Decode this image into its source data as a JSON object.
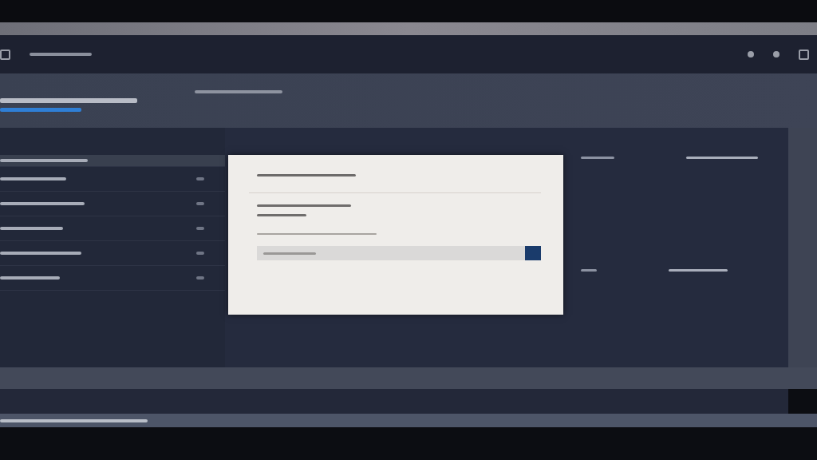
{
  "heading": {
    "tab_selected": true
  },
  "sidebar": {
    "rows": [
      {
        "selected": true
      },
      {
        "selected": false
      },
      {
        "selected": false
      },
      {
        "selected": false
      },
      {
        "selected": false
      },
      {
        "selected": false
      }
    ]
  },
  "table": {
    "rows": [
      {
        "selected": false
      },
      {
        "selected": false
      }
    ]
  },
  "dialog": {
    "open": true
  }
}
